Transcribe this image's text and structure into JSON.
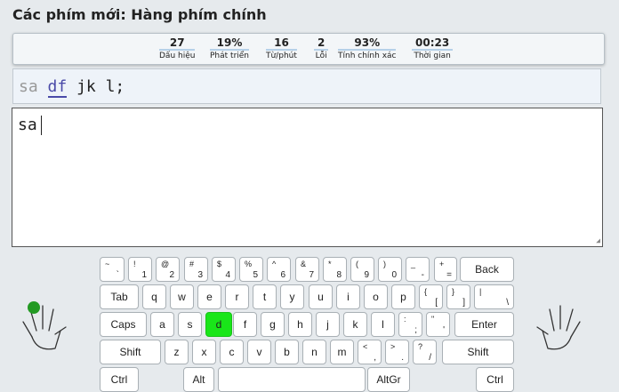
{
  "page": {
    "title": "Các phím mới: Hàng phím chính"
  },
  "stats": [
    {
      "value": "27",
      "label": "Dấu hiệu"
    },
    {
      "value": "19%",
      "label": "Phát triển"
    },
    {
      "value": "16",
      "label": "Từ/phút"
    },
    {
      "value": "2",
      "label": "Lỗi"
    },
    {
      "value": "93%",
      "label": "Tính chính xác"
    },
    {
      "value": "00:23",
      "label": "Thời gian"
    }
  ],
  "lesson": {
    "done": "sa",
    "current": "df",
    "rest1": "jk",
    "rest2": "l;"
  },
  "typing": {
    "text": "sa"
  },
  "keyboard": {
    "highlight_key": "d",
    "highlight_color": "#19e619",
    "rows": [
      [
        {
          "t": "~",
          "b": "`"
        },
        {
          "t": "!",
          "b": "1"
        },
        {
          "t": "@",
          "b": "2"
        },
        {
          "t": "#",
          "b": "3"
        },
        {
          "t": "$",
          "b": "4"
        },
        {
          "t": "%",
          "b": "5"
        },
        {
          "t": "^",
          "b": "6"
        },
        {
          "t": "&",
          "b": "7"
        },
        {
          "t": "*",
          "b": "8"
        },
        {
          "t": "(",
          "b": "9"
        },
        {
          "t": ")",
          "b": "0"
        },
        {
          "t": "_",
          "b": "-"
        },
        {
          "t": "+",
          "b": "="
        },
        {
          "c": "Back"
        }
      ],
      [
        {
          "c": "Tab"
        },
        {
          "c": "q"
        },
        {
          "c": "w"
        },
        {
          "c": "e"
        },
        {
          "c": "r"
        },
        {
          "c": "t"
        },
        {
          "c": "y"
        },
        {
          "c": "u"
        },
        {
          "c": "i"
        },
        {
          "c": "o"
        },
        {
          "c": "p"
        },
        {
          "t": "{",
          "b": "["
        },
        {
          "t": "}",
          "b": "]"
        },
        {
          "t": "|",
          "b": "\\"
        }
      ],
      [
        {
          "c": "Caps"
        },
        {
          "c": "a"
        },
        {
          "c": "s"
        },
        {
          "c": "d"
        },
        {
          "c": "f"
        },
        {
          "c": "g"
        },
        {
          "c": "h"
        },
        {
          "c": "j"
        },
        {
          "c": "k"
        },
        {
          "c": "l"
        },
        {
          "t": ":",
          "b": ";"
        },
        {
          "t": "\"",
          "b": "'"
        },
        {
          "c": "Enter"
        }
      ],
      [
        {
          "c": "Shift"
        },
        {
          "c": "z"
        },
        {
          "c": "x"
        },
        {
          "c": "c"
        },
        {
          "c": "v"
        },
        {
          "c": "b"
        },
        {
          "c": "n"
        },
        {
          "c": "m"
        },
        {
          "t": "<",
          "b": ","
        },
        {
          "t": ">",
          "b": "."
        },
        {
          "t": "?",
          "b": "/"
        },
        {
          "c": "Shift"
        }
      ],
      [
        {
          "c": "Ctrl"
        },
        {
          "c": "Alt"
        },
        {
          "c": ""
        },
        {
          "c": "AltGr"
        },
        {
          "c": "Ctrl"
        }
      ]
    ]
  },
  "icons": {
    "left_hand": "left-hand-icon",
    "right_hand": "right-hand-icon"
  }
}
